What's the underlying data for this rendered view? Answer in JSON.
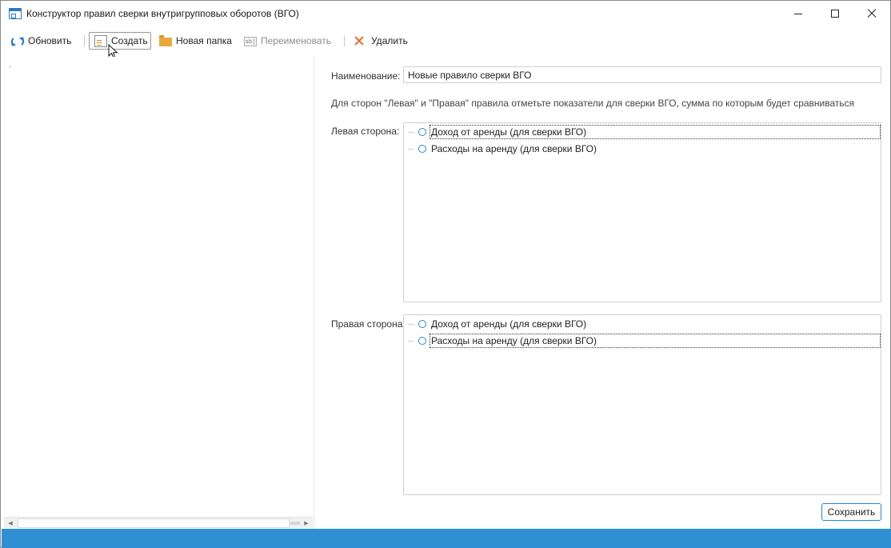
{
  "window": {
    "title": "Конструктор правил сверки внутригрупповых оборотов (ВГО)"
  },
  "toolbar": {
    "refresh_label": "Обновить",
    "create_label": "Создать",
    "new_folder_label": "Новая папка",
    "rename_label": "Переименовать",
    "delete_label": "Удалить"
  },
  "form": {
    "name_label": "Наименование:",
    "name_value": "Новые правило сверки ВГО",
    "hint": "Для сторон \"Левая\" и \"Правая\" правила отметьте показатели для сверки ВГО, сумма по которым будет сравниваться",
    "left_side_label": "Левая сторона:",
    "right_side_label": "Правая сторона",
    "left_items": [
      "Доход от аренды (для сверки ВГО)",
      "Расходы на аренду (для сверки ВГО)"
    ],
    "right_items": [
      "Доход от аренды (для сверки ВГО)",
      "Расходы на аренду (для сверки ВГО)"
    ],
    "save_label": "Сохранить"
  },
  "colors": {
    "accent": "#2e8fd2",
    "delete": "#e36b2a",
    "folder": "#e8a93c"
  }
}
